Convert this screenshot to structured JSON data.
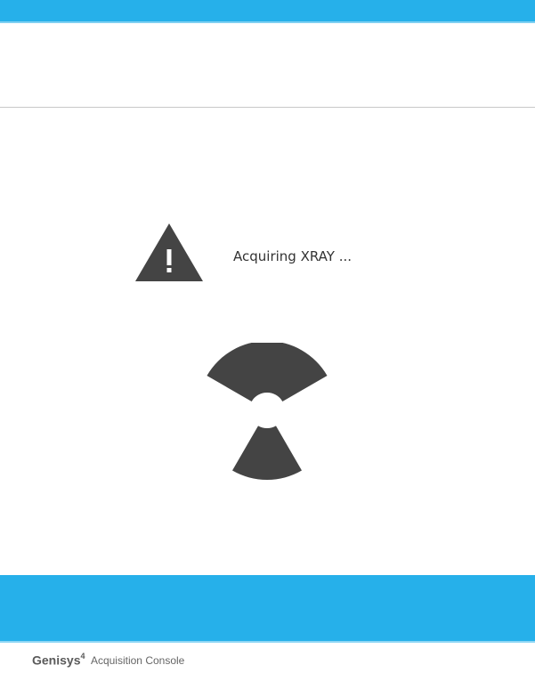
{
  "header": {
    "accent_color": "#26b0ea"
  },
  "status": {
    "message": "Acquiring XRAY ...",
    "warning_icon": "warning-triangle-icon",
    "activity_icon": "radiation-icon"
  },
  "footer": {
    "brand": "Genisys",
    "brand_superscript": "4",
    "product": "Acquisition Console"
  },
  "colors": {
    "accent": "#26b0ea",
    "icon": "#444444",
    "text": "#333333"
  }
}
